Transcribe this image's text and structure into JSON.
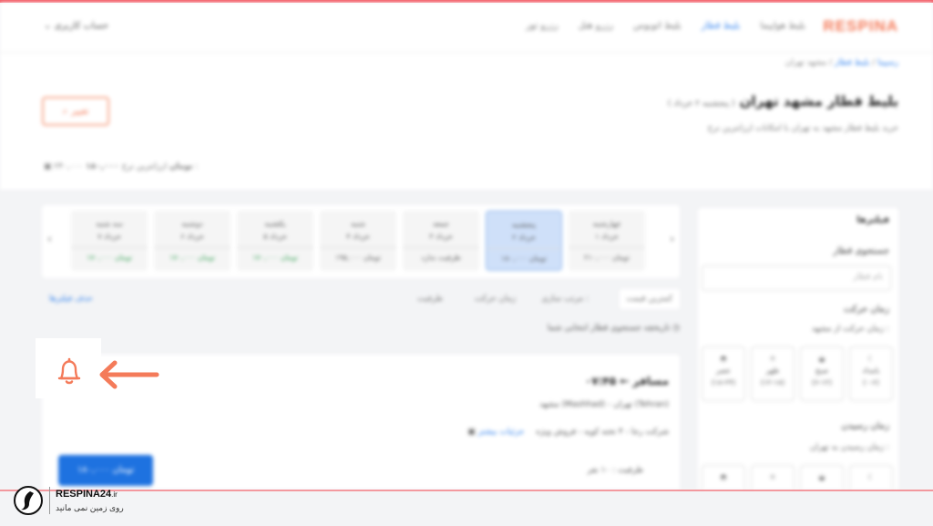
{
  "header": {
    "logo": "RESPINA",
    "nav": [
      "بلیط هواپیما",
      "بلیط قطار",
      "بلیط اتوبوس",
      "رزرو هتل",
      "رزرو تور"
    ],
    "active_nav": "بلیط قطار",
    "account": "حساب کاربری"
  },
  "breadcrumb": {
    "home": "رسپینا",
    "sep": "/",
    "section": "بلیط قطار",
    "current": "مشهد تهران"
  },
  "title": {
    "main": "بلیط قطار مشهد تهران",
    "date": "( پنجشنبه ۲ خرداد )",
    "sub": "خرید بلیط قطار مشهد به تهران با امکانات ارزانترین نرخ"
  },
  "search_button": "تغییر",
  "price_line": {
    "label": "ارزانترین نرخ :",
    "value": "۱۸۰,۰۰۰ تومان",
    "old": "۲۴۰,۰۰۰"
  },
  "sidebar": {
    "title": "فیلترها",
    "train_search": "جستجوی قطار",
    "train_placeholder": "نام قطار",
    "departure_title": "زمان حرکت",
    "departure_sub": "زمان حرکت از مشهد :",
    "arrival_title": "زمان رسیدن",
    "arrival_sub": "زمان رسیدن به تهران :",
    "times": [
      {
        "label": "بامداد",
        "range": "(۰-۶)"
      },
      {
        "label": "صبح",
        "range": "(۶-۱۲)"
      },
      {
        "label": "ظهر",
        "range": "(۱۲-۱۸)"
      },
      {
        "label": "عصر",
        "range": "(۱۸-۲۴)"
      }
    ]
  },
  "days": [
    {
      "day": "چهارشنبه",
      "date": "۱ خرداد",
      "price": "۲۱۰,۰۰۰ تومان",
      "green": false
    },
    {
      "day": "پنجشنبه",
      "date": "۲ خرداد",
      "price": "۱۸۰,۰۰۰ تومان",
      "green": false
    },
    {
      "day": "جمعه",
      "date": "۳ خرداد",
      "price": "ظرفیت ندارد",
      "green": false
    },
    {
      "day": "شنبه",
      "date": "۴ خرداد",
      "price": "۱۹۵,۰۰۰ تومان",
      "green": false
    },
    {
      "day": "یکشنبه",
      "date": "۵ خرداد",
      "price": "۱۷۰,۰۰۰ تومان",
      "green": true
    },
    {
      "day": "دوشنبه",
      "date": "۶ خرداد",
      "price": "۱۷۰,۰۰۰ تومان",
      "green": true
    },
    {
      "day": "سه شنبه",
      "date": "۷ خرداد",
      "price": "۱۷۰,۰۰۰ تومان",
      "green": true
    }
  ],
  "filters": {
    "sort": "مرتب سازی :",
    "sort_button": "کمترین قیمت",
    "opt1": "زمان حرکت",
    "opt2": "ظرفیت",
    "clear": "حذف فیلترها"
  },
  "history": "تاریخچه جستجوی قطار انتخابی شما",
  "card": {
    "time_from": "۰۷:۴۵",
    "arrow": "←",
    "time_to": "مسافر",
    "route": "مشهد (Mashhad) - تهران (Tehran)",
    "company": "شرکت رجا - ۴ تخته کوپه - فروش ویژه",
    "details": "جزئیات بیشتر",
    "seats": "ظرفیت : ۱۰ نفر",
    "buy": "۱۸۰,۰۰۰ تومان"
  },
  "brand": {
    "name": "RESPINA24",
    "tld": ".ir",
    "slogan": "روی زمین نمی مانید"
  },
  "colors": {
    "accent": "#f47b5a",
    "primary": "#1e72e0",
    "rule": "#f25a64"
  }
}
